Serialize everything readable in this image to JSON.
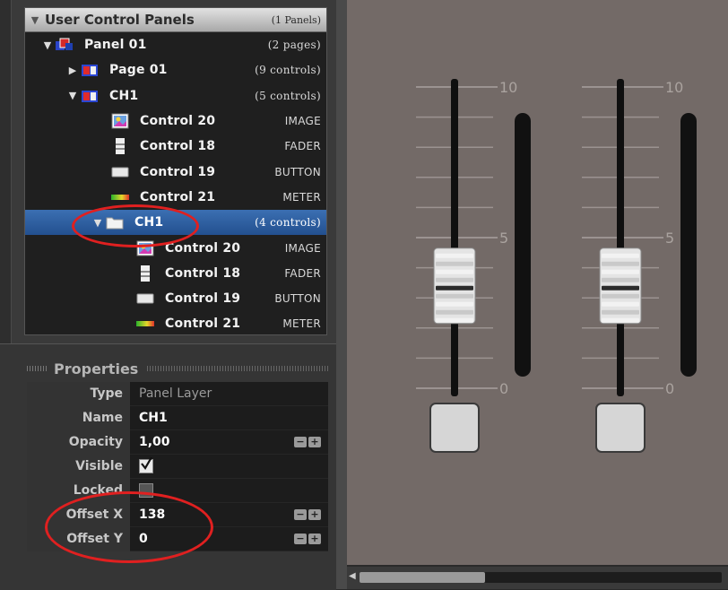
{
  "tree": {
    "header": {
      "title": "User Control Panels",
      "count": "(1 Panels)"
    },
    "rows": [
      {
        "label": "Panel 01",
        "meta": "(2 pages)",
        "indent": 18,
        "toggle": "▼",
        "icon": "panel-icon"
      },
      {
        "label": "Page 01",
        "meta": "(9 controls)",
        "indent": 46,
        "toggle": "▶",
        "icon": "page-icon"
      },
      {
        "label": "CH1",
        "meta": "(5 controls)",
        "indent": 46,
        "toggle": "▼",
        "icon": "page-icon"
      },
      {
        "label": "Control 20",
        "meta": "IMAGE",
        "indent": 80,
        "toggle": "",
        "icon": "image-icon"
      },
      {
        "label": "Control 18",
        "meta": "FADER",
        "indent": 80,
        "toggle": "",
        "icon": "fader-icon"
      },
      {
        "label": "Control 19",
        "meta": "BUTTON",
        "indent": 80,
        "toggle": "",
        "icon": "button-icon"
      },
      {
        "label": "Control 21",
        "meta": "METER",
        "indent": 80,
        "toggle": "",
        "icon": "meter-icon"
      },
      {
        "label": "CH1",
        "meta": "(4 controls)",
        "indent": 74,
        "toggle": "▼",
        "icon": "folder-icon",
        "selected": true
      },
      {
        "label": "Control 20",
        "meta": "IMAGE",
        "indent": 108,
        "toggle": "",
        "icon": "image-icon"
      },
      {
        "label": "Control 18",
        "meta": "FADER",
        "indent": 108,
        "toggle": "",
        "icon": "fader-icon"
      },
      {
        "label": "Control 19",
        "meta": "BUTTON",
        "indent": 108,
        "toggle": "",
        "icon": "button-icon"
      },
      {
        "label": "Control 21",
        "meta": "METER",
        "indent": 108,
        "toggle": "",
        "icon": "meter-icon"
      }
    ]
  },
  "properties": {
    "title": "Properties",
    "rows": {
      "type": {
        "label": "Type",
        "value": "Panel Layer"
      },
      "name": {
        "label": "Name",
        "value": "CH1"
      },
      "opacity": {
        "label": "Opacity",
        "value": "1,00"
      },
      "visible": {
        "label": "Visible",
        "checked": true
      },
      "locked": {
        "label": "Locked",
        "checked": false
      },
      "offset_x": {
        "label": "Offset X",
        "value": "138"
      },
      "offset_y": {
        "label": "Offset Y",
        "value": "0"
      }
    },
    "stepper": {
      "minus": "−",
      "plus": "+"
    }
  },
  "canvas": {
    "faders": [
      {
        "scale_top": "10",
        "scale_mid": "5",
        "scale_bottom": "0",
        "level": 0.34,
        "meter_level": 0
      },
      {
        "scale_top": "10",
        "scale_mid": "5",
        "scale_bottom": "0",
        "level": 0.34,
        "meter_level": 0
      }
    ]
  },
  "colors": {
    "selection": "#2c5fa3",
    "canvas_bg": "#736a67",
    "annotation": "#e02020"
  }
}
